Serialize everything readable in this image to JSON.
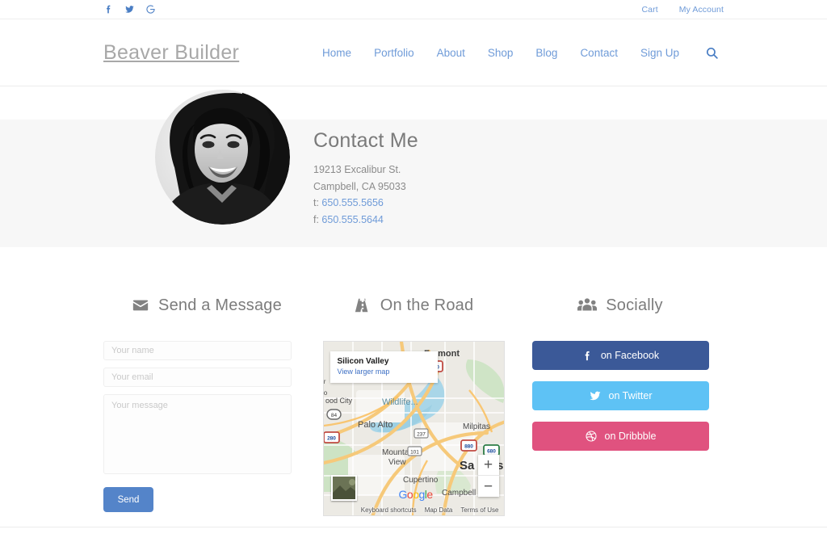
{
  "topbar": {
    "social": [
      {
        "name": "facebook-icon",
        "label": "Facebook"
      },
      {
        "name": "twitter-icon",
        "label": "Twitter"
      },
      {
        "name": "google-icon",
        "label": "Google"
      }
    ],
    "links": [
      {
        "label": "Cart"
      },
      {
        "label": "My Account"
      }
    ]
  },
  "header": {
    "logo": "Beaver Builder",
    "nav": [
      {
        "label": "Home"
      },
      {
        "label": "Portfolio"
      },
      {
        "label": "About"
      },
      {
        "label": "Shop"
      },
      {
        "label": "Blog"
      },
      {
        "label": "Contact"
      },
      {
        "label": "Sign Up"
      }
    ],
    "search_icon": "search-icon"
  },
  "hero": {
    "title": "Contact Me",
    "street": "19213 Excalibur St.",
    "city": "Campbell, CA 95033",
    "phone_prefix": "t: ",
    "phone": "650.555.5656",
    "fax_prefix": "f: ",
    "fax": "650.555.5644",
    "portrait_alt": "profile-portrait"
  },
  "columns": {
    "message": {
      "icon": "envelope-icon",
      "heading": "Send a Message",
      "fields": {
        "name_placeholder": "Your name",
        "name_value": "",
        "email_placeholder": "Your email",
        "email_value": "",
        "message_placeholder": "Your message",
        "message_value": ""
      },
      "send_label": "Send"
    },
    "road": {
      "icon": "road-icon",
      "heading": "On the Road",
      "map": {
        "card_title": "Silicon Valley",
        "card_link": "View larger map",
        "labels": [
          "Fremont",
          "Wildlife...",
          "Palo Alto",
          "Milpitas",
          "Mountain",
          "View",
          "Cupertino",
          "Campbell",
          "ood City",
          "Sa",
          "s"
        ],
        "shields": [
          "880",
          "84",
          "280",
          "237",
          "101",
          "880",
          "680"
        ],
        "zoom_in": "+",
        "zoom_out": "−",
        "brand": "Google",
        "footer": [
          "Keyboard shortcuts",
          "Map Data",
          "Terms of Use"
        ]
      }
    },
    "social": {
      "icon": "users-icon",
      "heading": "Socially",
      "buttons": [
        {
          "label": "on Facebook",
          "icon": "facebook-icon",
          "color": "#3b5998"
        },
        {
          "label": "on Twitter",
          "icon": "twitter-icon",
          "color": "#5ec2f5"
        },
        {
          "label": "on Dribbble",
          "icon": "dribbble-icon",
          "color": "#e0527f"
        }
      ]
    }
  },
  "theme": {
    "link_blue": "#6f9bd8",
    "accent_blue": "#5484c9",
    "hero_bg": "#f7f7f7",
    "heading_gray": "#7c7c7c"
  }
}
